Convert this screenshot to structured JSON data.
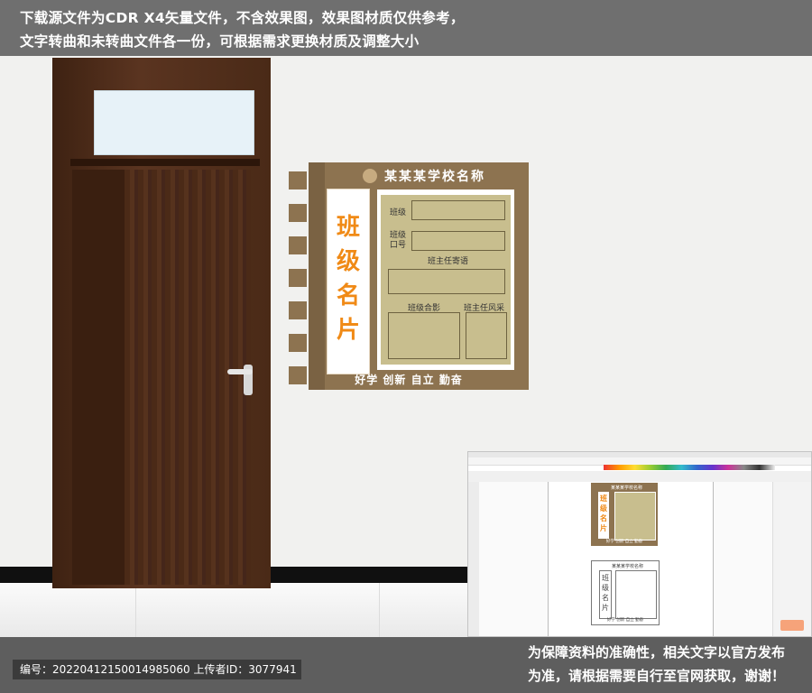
{
  "banner": {
    "line1": "下载源文件为CDR X4矢量文件，不含效果图，效果图材质仅供参考，",
    "line2": "文字转曲和未转曲文件各一份，可根据需求更换材质及调整大小"
  },
  "board": {
    "school_name": "某某某学校名称",
    "title_chars": [
      "班",
      "级",
      "名",
      "片"
    ],
    "fields": {
      "class": "班级",
      "slogan_label": "班级\n口号",
      "teacher_message": "班主任寄语",
      "class_photo": "班级合影",
      "teacher_style": "班主任风采"
    },
    "slogan": "好学  创新  自立  勤奋"
  },
  "thumbnail": {
    "school_name": "某某某学校名称",
    "title": "班级名片",
    "slogan": "好学  创新  自立  勤奋"
  },
  "footer": {
    "id_text": "编号：20220412150014985060 上传者ID：3077941",
    "notice_line1": "为保障资料的准确性，相关文字以官方发布",
    "notice_line2": "为准，请根据需要自行至官网获取，谢谢！"
  },
  "colors": {
    "board_brown": "#8d7350",
    "panel_beige": "#c8be8e",
    "title_orange": "#f08a16",
    "door_wood": "#4b2a17"
  }
}
